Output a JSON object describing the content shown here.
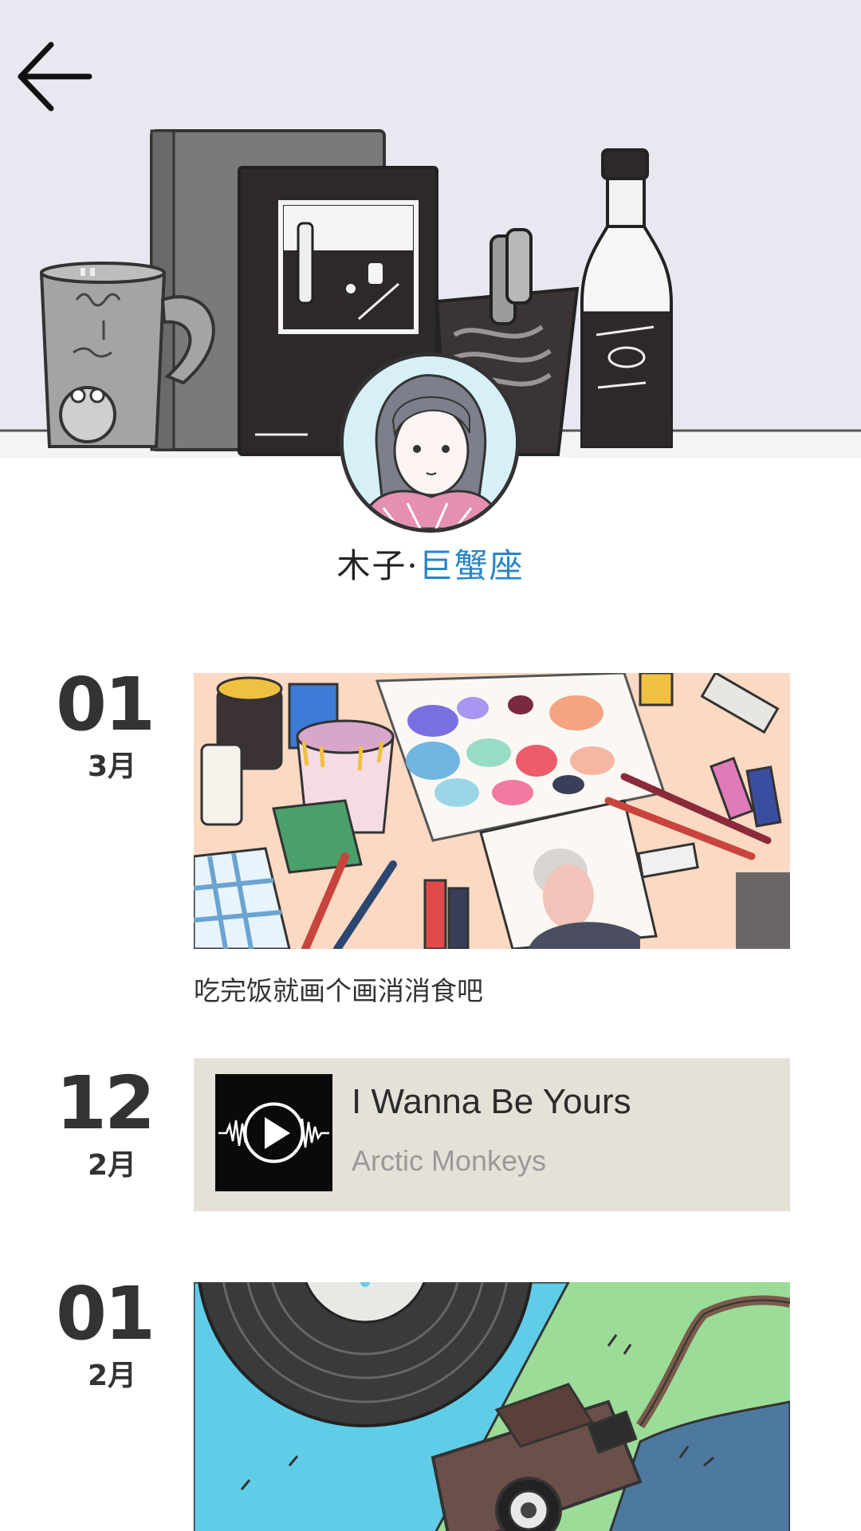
{
  "header": {
    "back_icon": "arrow-left-icon",
    "cover_theme": "desk-still-life",
    "background": "#e9e8f1"
  },
  "profile": {
    "name": "木子·",
    "sign": "巨蟹座",
    "sign_color": "#2a85c6"
  },
  "timeline": [
    {
      "type": "image",
      "day": "01",
      "month": "3月",
      "image_icon": "painting-supplies-illustration",
      "caption": "吃完饭就画个画消消食吧"
    },
    {
      "type": "music",
      "day": "12",
      "month": "2月",
      "cover_icon": "play-waveform-icon",
      "title": "I Wanna Be Yours",
      "artist": "Arctic Monkeys"
    },
    {
      "type": "image",
      "day": "01",
      "month": "2月",
      "image_icon": "vinyl-camera-illustration"
    }
  ]
}
